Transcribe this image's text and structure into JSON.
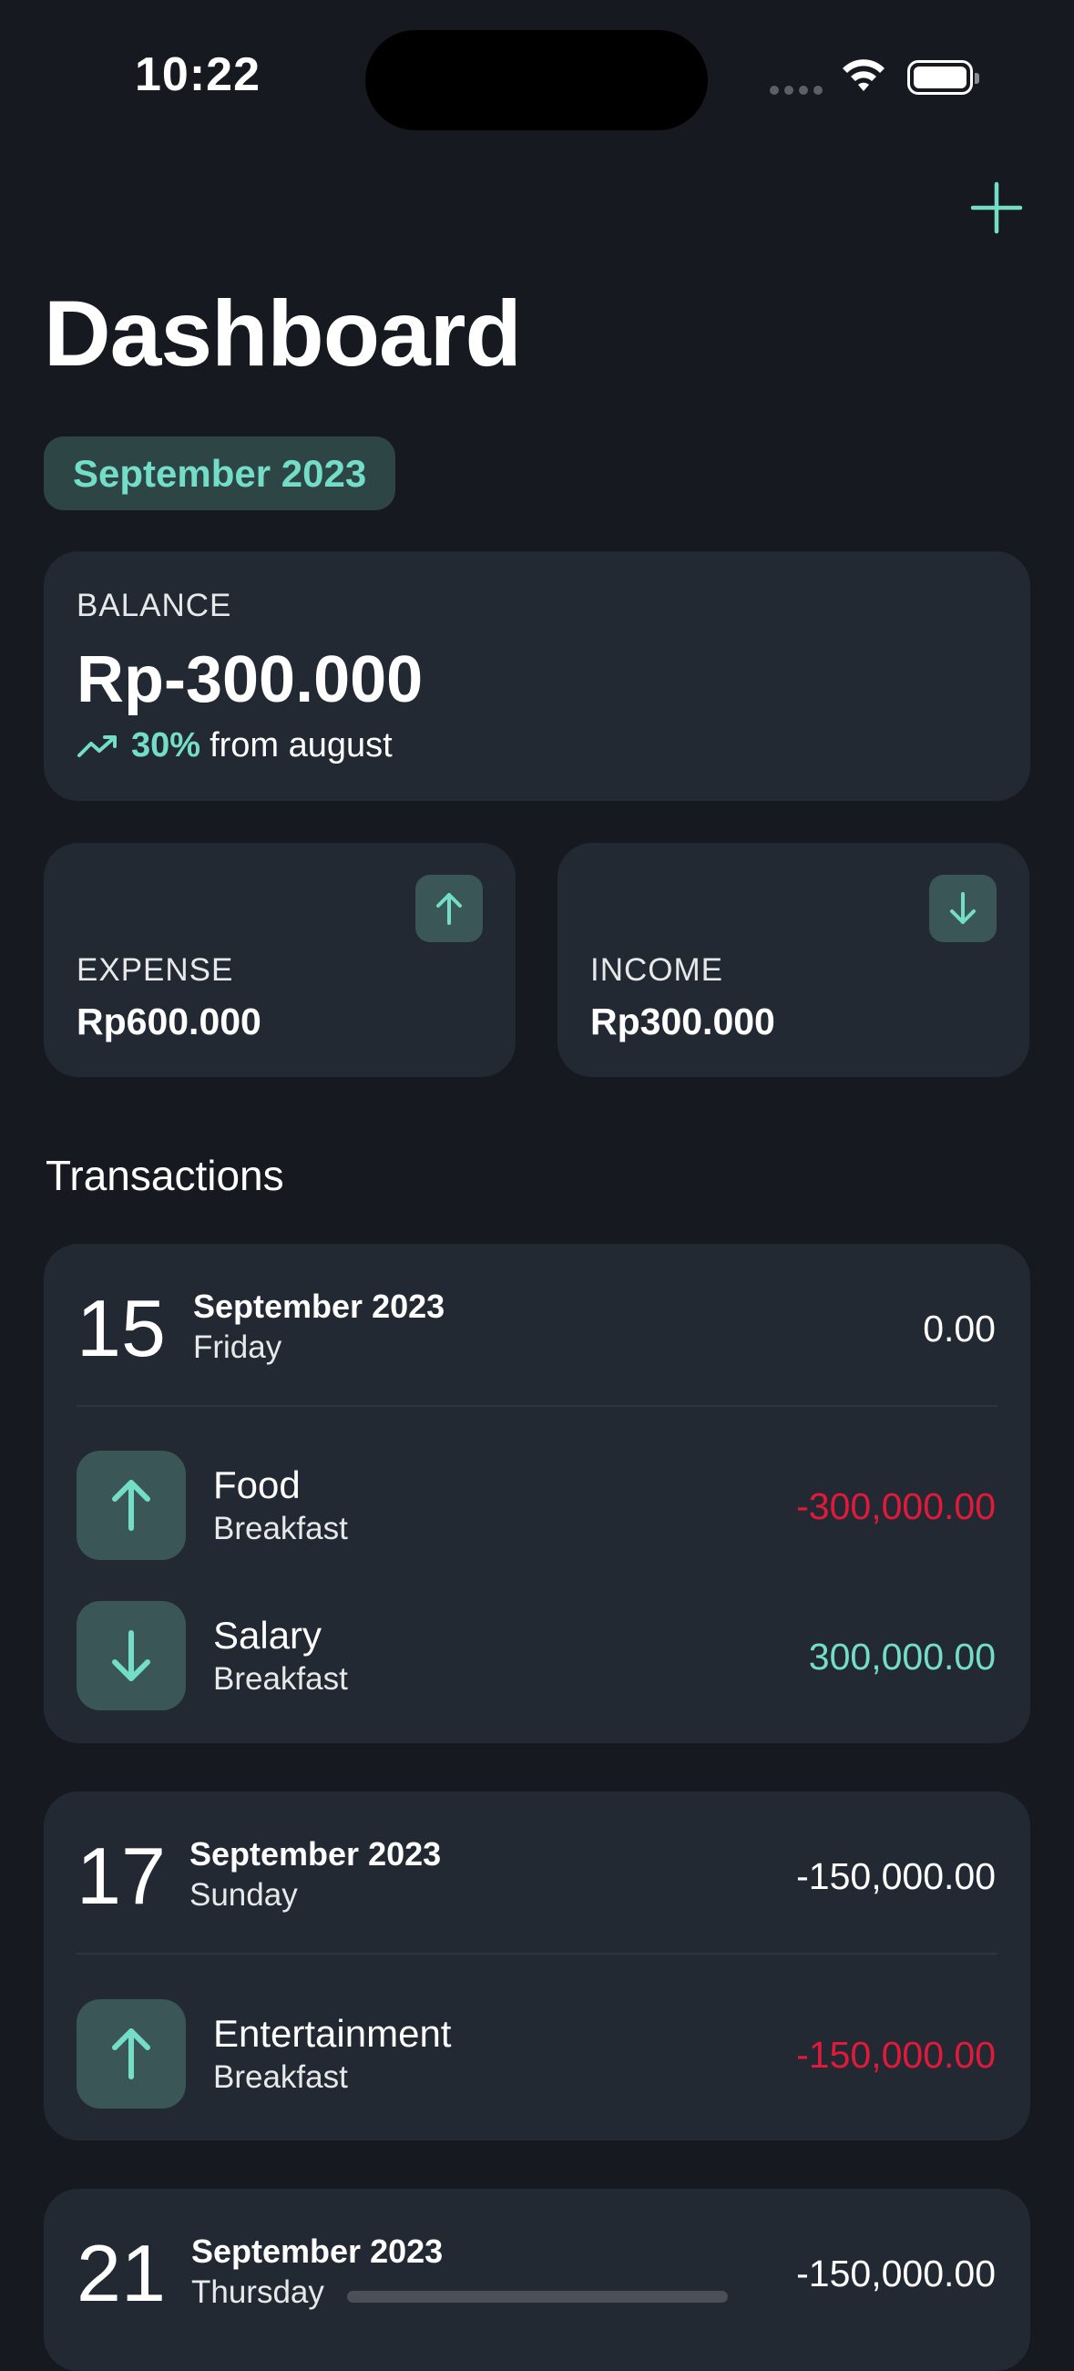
{
  "status_bar": {
    "time": "10:22"
  },
  "header": {
    "title": "Dashboard",
    "add_icon": "plus-icon"
  },
  "month_filter": {
    "label": "September 2023"
  },
  "balance": {
    "label": "BALANCE",
    "value": "Rp-300.000",
    "trend_icon": "trending-up-icon",
    "trend_percent": "30%",
    "trend_text": "from august"
  },
  "stats": {
    "expense": {
      "label": "EXPENSE",
      "value": "Rp600.000",
      "icon": "arrow-up-icon"
    },
    "income": {
      "label": "INCOME",
      "value": "Rp300.000",
      "icon": "arrow-down-icon"
    }
  },
  "transactions": {
    "title": "Transactions",
    "groups": [
      {
        "day": "15",
        "month": "September 2023",
        "weekday": "Friday",
        "total": "0.00",
        "items": [
          {
            "category": "Food",
            "note": "Breakfast",
            "amount": "-300,000.00",
            "type": "expense",
            "icon": "arrow-up-icon"
          },
          {
            "category": "Salary",
            "note": "Breakfast",
            "amount": "300,000.00",
            "type": "income",
            "icon": "arrow-down-icon"
          }
        ]
      },
      {
        "day": "17",
        "month": "September 2023",
        "weekday": "Sunday",
        "total": "-150,000.00",
        "items": [
          {
            "category": "Entertainment",
            "note": "Breakfast",
            "amount": "-150,000.00",
            "type": "expense",
            "icon": "arrow-up-icon"
          }
        ]
      },
      {
        "day": "21",
        "month": "September 2023",
        "weekday": "Thursday",
        "total": "-150,000.00",
        "items": []
      }
    ]
  },
  "colors": {
    "background": "#161a20",
    "card": "#232933",
    "accent": "#74ddc8",
    "negative": "#e1193a",
    "icon_bg": "#3a5657"
  }
}
